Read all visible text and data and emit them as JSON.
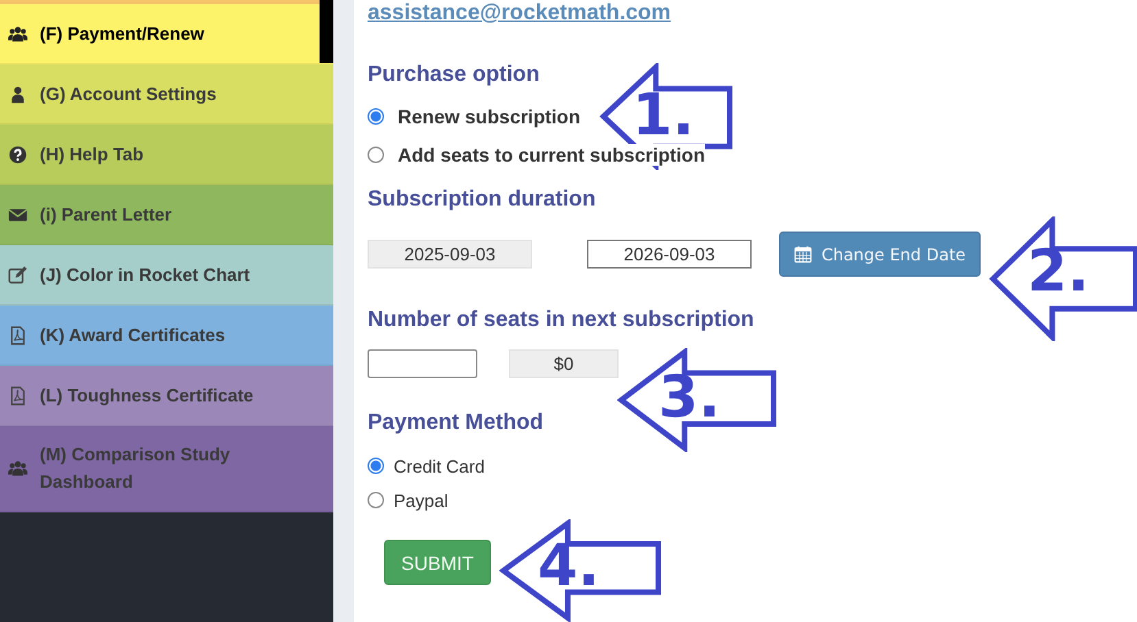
{
  "sidebar": {
    "items": [
      {
        "label": "(F) Payment/Renew",
        "selected": true,
        "color": "#fdf36b"
      },
      {
        "label": "(G) Account Settings",
        "selected": false,
        "color": "#d7de62"
      },
      {
        "label": "(H) Help Tab",
        "selected": false,
        "color": "#b8cc5c"
      },
      {
        "label": "(i) Parent Letter",
        "selected": false,
        "color": "#8fb85e"
      },
      {
        "label": "(J) Color in Rocket Chart",
        "selected": false,
        "color": "#a5cdc9"
      },
      {
        "label": "(K) Award Certificates",
        "selected": false,
        "color": "#7fb1de"
      },
      {
        "label": "(L) Toughness Certificate",
        "selected": false,
        "color": "#9b87b8"
      },
      {
        "label": "(M) Comparison Study Dashboard",
        "selected": false,
        "color": "#7e67a3"
      }
    ]
  },
  "email": "assistance@rocketmath.com",
  "purchase": {
    "heading": "Purchase option",
    "options": [
      {
        "label": "Renew subscription",
        "selected": true
      },
      {
        "label": "Add seats to current subscription",
        "selected": false
      }
    ]
  },
  "duration": {
    "heading": "Subscription duration",
    "start": "2025-09-03",
    "end": "2026-09-03",
    "button": "Change End Date"
  },
  "seats": {
    "heading": "Number of seats in next subscription",
    "price": "$0"
  },
  "payment": {
    "heading": "Payment Method",
    "options": [
      {
        "label": "Credit Card",
        "selected": true
      },
      {
        "label": "Paypal",
        "selected": false
      }
    ]
  },
  "submit": "SUBMIT",
  "annotations": [
    {
      "label": "1."
    },
    {
      "label": "2."
    },
    {
      "label": "3."
    },
    {
      "label": "4."
    }
  ]
}
